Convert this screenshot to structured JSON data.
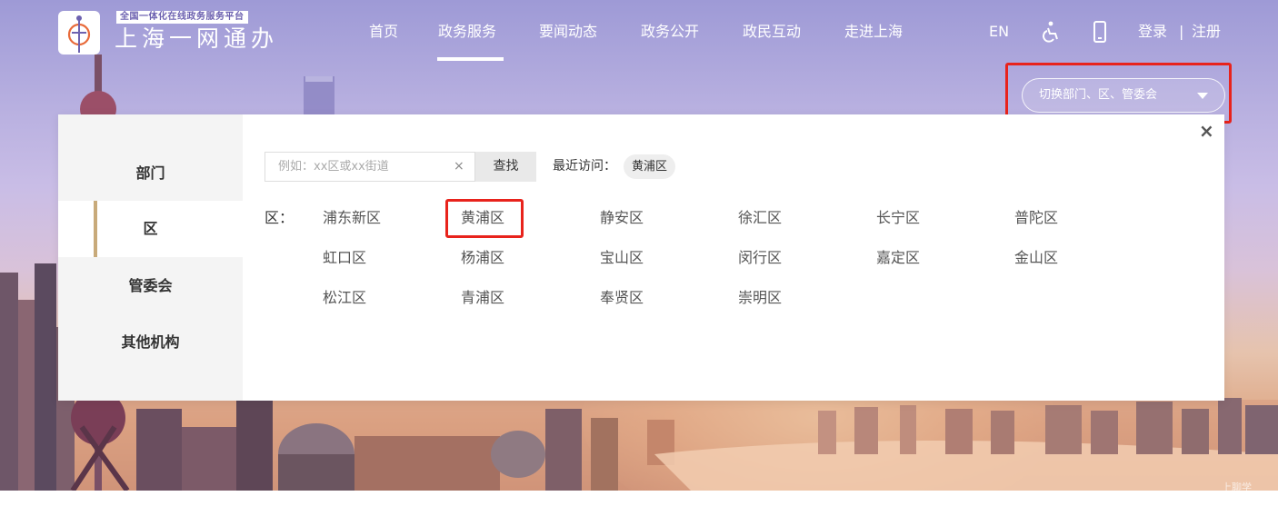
{
  "brand": {
    "tagline": "全国一体化在线政务服务平台",
    "name": "上海一网通办"
  },
  "nav": {
    "items": [
      "首页",
      "政务服务",
      "要闻动态",
      "政务公开",
      "政民互动",
      "走进上海"
    ],
    "active": "政务服务"
  },
  "tools": {
    "lang": "EN",
    "accessibility_icon": "accessibility-icon",
    "mobile_icon": "mobile-icon",
    "login": "登录",
    "separator": "|",
    "register": "注册"
  },
  "switcher": {
    "label": "切换部门、区、管委会"
  },
  "panel": {
    "close": "×",
    "sidebar": [
      "部门",
      "区",
      "管委会",
      "其他机构"
    ],
    "active_tab": "区",
    "search": {
      "placeholder": "例如：xx区或xx街道",
      "clear": "×",
      "button": "查找"
    },
    "recent": {
      "label": "最近访问：",
      "items": [
        "黄浦区"
      ]
    },
    "districts_label": "区：",
    "districts": [
      [
        "浦东新区",
        "黄浦区",
        "静安区",
        "徐汇区",
        "长宁区",
        "普陀区"
      ],
      [
        "虹口区",
        "杨浦区",
        "宝山区",
        "闵行区",
        "嘉定区",
        "金山区"
      ],
      [
        "松江区",
        "青浦区",
        "奉贤区",
        "崇明区"
      ]
    ],
    "highlighted": "黄浦区"
  },
  "colors": {
    "accent_bar": "#c8aa7a",
    "highlight_red": "#e8231c"
  },
  "watermark": "上聊学"
}
